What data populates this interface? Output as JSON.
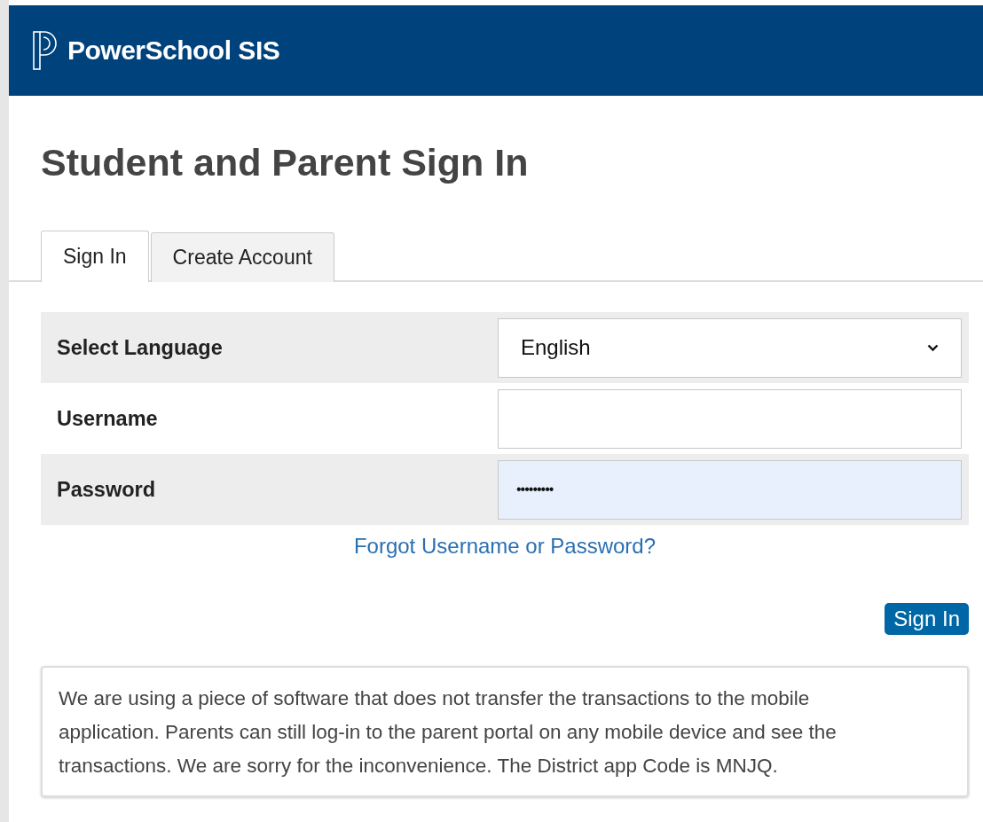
{
  "header": {
    "title": "PowerSchool SIS"
  },
  "page_title": "Student and Parent Sign In",
  "tabs": [
    {
      "label": "Sign In",
      "selected": true
    },
    {
      "label": "Create Account",
      "selected": false
    }
  ],
  "form": {
    "rows": [
      {
        "kind": "select",
        "label": "Select Language",
        "value": "English",
        "highlighted": false
      },
      {
        "kind": "text",
        "label": "Username",
        "highlighted": false
      },
      {
        "kind": "password",
        "label": "Password",
        "value": "•••••••••",
        "highlighted": true
      }
    ]
  },
  "forgot_link": "Forgot Username or Password?",
  "submit_button": "Sign In",
  "notice": "We are using a piece of software that does not transfer the transactions to the mobile application. Parents can still log-in to the parent portal on any mobile device and see the transactions. We are sorry for the inconvenience. The District app Code is MNJQ."
}
